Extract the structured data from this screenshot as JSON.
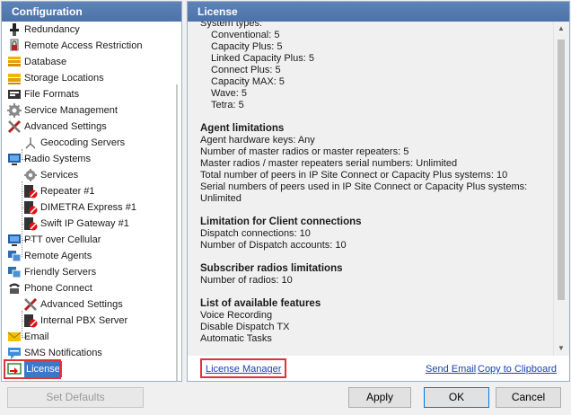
{
  "left_panel": {
    "title": "Configuration",
    "items": [
      {
        "label": "Redundancy",
        "icon": "redundancy-icon"
      },
      {
        "label": "Remote Access Restriction",
        "icon": "lock-icon"
      },
      {
        "label": "Database",
        "icon": "database-icon"
      },
      {
        "label": "Storage Locations",
        "icon": "storage-icon"
      },
      {
        "label": "File Formats",
        "icon": "file-formats-icon"
      },
      {
        "label": "Service Management",
        "icon": "gear-icon"
      },
      {
        "label": "Advanced Settings",
        "icon": "tools-icon"
      },
      {
        "label": "Geocoding Servers",
        "icon": "geocoding-icon"
      },
      {
        "label": "Radio Systems",
        "icon": "radio-systems-icon"
      },
      {
        "label": "Services",
        "icon": "gear-icon"
      },
      {
        "label": "Repeater #1",
        "icon": "repeater-disabled-icon"
      },
      {
        "label": "DIMETRA Express #1",
        "icon": "repeater-disabled-icon"
      },
      {
        "label": "Swift IP Gateway #1",
        "icon": "repeater-disabled-icon"
      },
      {
        "label": "PTT over Cellular",
        "icon": "ptt-cellular-icon"
      },
      {
        "label": "Remote Agents",
        "icon": "remote-agents-icon"
      },
      {
        "label": "Friendly Servers",
        "icon": "friendly-servers-icon"
      },
      {
        "label": "Phone Connect",
        "icon": "phone-icon"
      },
      {
        "label": "Advanced Settings",
        "icon": "tools-icon"
      },
      {
        "label": "Internal PBX Server",
        "icon": "pbx-disabled-icon"
      },
      {
        "label": "Email",
        "icon": "email-icon"
      },
      {
        "label": "SMS Notifications",
        "icon": "sms-icon"
      },
      {
        "label": "License",
        "icon": "license-icon"
      }
    ]
  },
  "right_panel": {
    "title": "License",
    "system_types_label": "System types:",
    "system_types": [
      "Conventional: 5",
      "Capacity Plus: 5",
      "Linked Capacity Plus: 5",
      "Connect Plus: 5",
      "Capacity MAX: 5",
      "Wave: 5",
      "Tetra: 5"
    ],
    "agent_limitations": {
      "heading": "Agent limitations",
      "lines": [
        "Agent hardware keys: Any",
        "Number of master radios or master repeaters: 5",
        "Master radios / master repeaters serial numbers: Unlimited",
        "Total number of peers in IP Site Connect or Capacity Plus systems: 10",
        "Serial numbers of peers used in IP Site Connect or Capacity Plus systems:",
        "Unlimited"
      ]
    },
    "client_limitations": {
      "heading": "Limitation for Client connections",
      "lines": [
        "Dispatch connections: 10",
        "Number of Dispatch accounts: 10"
      ]
    },
    "subscriber_limitations": {
      "heading": "Subscriber radios limitations",
      "lines": [
        "Number of radios: 10"
      ]
    },
    "features": {
      "heading": "List of available features",
      "lines": [
        "Voice Recording",
        "Disable Dispatch TX",
        "Automatic Tasks"
      ]
    },
    "links": {
      "license_manager": "License Manager",
      "send_email": "Send Email",
      "copy_clipboard": "Copy to Clipboard"
    }
  },
  "buttons": {
    "set_defaults": "Set Defaults",
    "apply": "Apply",
    "ok": "OK",
    "cancel": "Cancel"
  },
  "colors": {
    "header": "#4c72a8",
    "selection": "#3a78c8",
    "highlight_box": "#e0313a",
    "link": "#1a40b8"
  }
}
